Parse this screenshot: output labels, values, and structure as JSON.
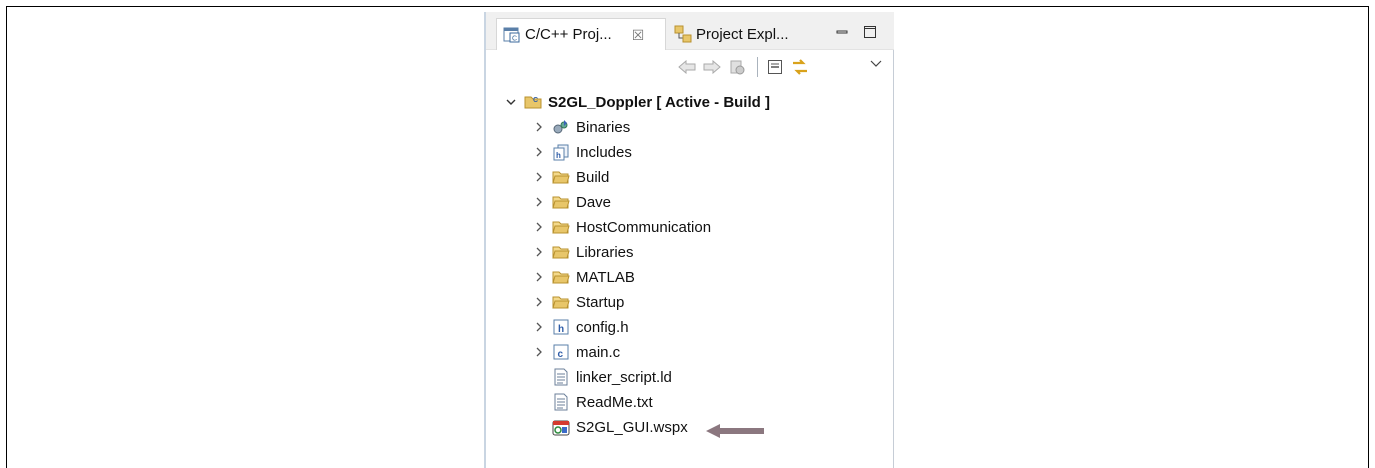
{
  "tabs": [
    {
      "label": "C/C++ Proj...",
      "icon": "cpp-projects-icon",
      "active": true,
      "close": "☒"
    },
    {
      "label": "Project Expl...",
      "icon": "project-explorer-icon",
      "active": false
    }
  ],
  "window_controls": [
    "minimize-icon",
    "maximize-icon"
  ],
  "toolbar": [
    "back-icon",
    "forward-icon",
    "link-settings-icon",
    "collapse-all-icon",
    "link-with-editor-icon"
  ],
  "view_menu_icon": "view-menu-chevron-icon",
  "tree": {
    "root": {
      "label": "S2GL_Doppler [ Active - Build ]",
      "icon": "c-project-folder-icon",
      "expanded": true
    },
    "items": [
      {
        "label": "Binaries",
        "icon": "binaries-icon",
        "expandable": true
      },
      {
        "label": "Includes",
        "icon": "includes-icon",
        "expandable": true
      },
      {
        "label": "Build",
        "icon": "folder-icon",
        "expandable": true
      },
      {
        "label": "Dave",
        "icon": "folder-icon",
        "expandable": true
      },
      {
        "label": "HostCommunication",
        "icon": "folder-icon",
        "expandable": true
      },
      {
        "label": "Libraries",
        "icon": "folder-icon",
        "expandable": true
      },
      {
        "label": "MATLAB",
        "icon": "folder-icon",
        "expandable": true
      },
      {
        "label": "Startup",
        "icon": "folder-icon",
        "expandable": true
      },
      {
        "label": "config.h",
        "icon": "header-file-icon",
        "expandable": true
      },
      {
        "label": "main.c",
        "icon": "c-file-icon",
        "expandable": true
      },
      {
        "label": "linker_script.ld",
        "icon": "text-file-icon",
        "expandable": false
      },
      {
        "label": "ReadMe.txt",
        "icon": "text-file-icon",
        "expandable": false
      },
      {
        "label": "S2GL_GUI.wspx",
        "icon": "wspx-file-icon",
        "expandable": false
      }
    ]
  },
  "colors": {
    "folder": "#e8c66a",
    "arrow": "#8b777f",
    "tab_bg": "#f0f0f0",
    "panel_border": "#c9d5e2"
  }
}
